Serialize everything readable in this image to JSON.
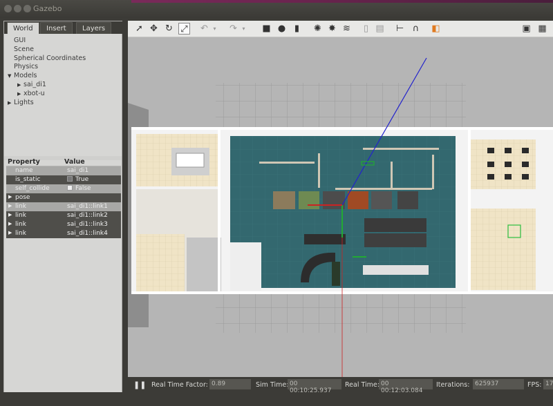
{
  "window": {
    "title": "Gazebo"
  },
  "tabs": [
    "World",
    "Insert",
    "Layers"
  ],
  "tree": {
    "items": [
      {
        "label": "GUI",
        "indent": 0,
        "arrow": ""
      },
      {
        "label": "Scene",
        "indent": 0,
        "arrow": ""
      },
      {
        "label": "Spherical Coordinates",
        "indent": 0,
        "arrow": ""
      },
      {
        "label": "Physics",
        "indent": 0,
        "arrow": ""
      },
      {
        "label": "Models",
        "indent": 0,
        "arrow": "▼"
      },
      {
        "label": "sai_di1",
        "indent": 1,
        "arrow": "▶"
      },
      {
        "label": "xbot-u",
        "indent": 1,
        "arrow": "▶"
      },
      {
        "label": "Lights",
        "indent": 0,
        "arrow": "▶"
      }
    ]
  },
  "properties": {
    "header_property": "Property",
    "header_value": "Value",
    "rows": [
      {
        "key": "name",
        "value": "sai_di1",
        "style": "light",
        "expand": false,
        "check": ""
      },
      {
        "key": "is_static",
        "value": "True",
        "style": "dark",
        "expand": false,
        "check": "on"
      },
      {
        "key": "self_collide",
        "value": "False",
        "style": "light",
        "expand": false,
        "check": "off"
      },
      {
        "key": "pose",
        "value": "",
        "style": "dark",
        "expand": true,
        "check": ""
      },
      {
        "key": "link",
        "value": "sai_di1::link1",
        "style": "light",
        "expand": true,
        "check": ""
      },
      {
        "key": "link",
        "value": "sai_di1::link2",
        "style": "dark",
        "expand": true,
        "check": ""
      },
      {
        "key": "link",
        "value": "sai_di1::link3",
        "style": "dark",
        "expand": true,
        "check": ""
      },
      {
        "key": "link",
        "value": "sai_di1::link4",
        "style": "dark",
        "expand": true,
        "check": ""
      }
    ]
  },
  "toolbar": {
    "icons": [
      "select-arrow-icon",
      "translate-icon",
      "rotate-icon",
      "scale-icon",
      "undo-icon",
      "undo-dropdown-icon",
      "redo-icon",
      "redo-dropdown-icon",
      "box-icon",
      "sphere-icon",
      "cylinder-icon",
      "point-light-icon",
      "spot-light-icon",
      "directional-light-icon",
      "copy-icon",
      "paste-icon",
      "align-icon",
      "snap-icon",
      "color-icon",
      "screenshot-icon",
      "record-icon"
    ]
  },
  "status": {
    "pause_icon": "pause-icon",
    "real_time_factor_label": "Real Time Factor:",
    "real_time_factor": "0.89",
    "sim_time_label": "Sim Time:",
    "sim_time": "00 00:10:25.937",
    "real_time_label": "Real Time:",
    "real_time": "00 00:12:03.084",
    "iterations_label": "Iterations:",
    "iterations": "625937",
    "fps_label": "FPS:",
    "fps": "17"
  }
}
